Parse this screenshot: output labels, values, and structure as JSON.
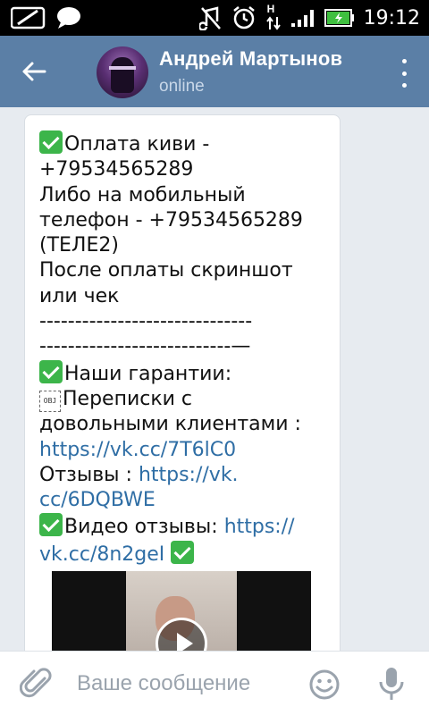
{
  "status_bar": {
    "time": "19:12",
    "icons": [
      "messenger-icon",
      "chat-bubble-icon",
      "mute-icon",
      "alarm-icon",
      "data-arrows-icon",
      "signal-icon",
      "battery-icon"
    ],
    "network_label": "H"
  },
  "header": {
    "contact_name": "Андрей Мартынов",
    "contact_status": "online",
    "back_icon": "back-arrow-icon",
    "menu_icon": "more-vert-icon"
  },
  "message": {
    "line1": "Оплата киви -",
    "line2": "+79534565289",
    "line3": "Либо на мобильный",
    "line4": "телефон - +79534565289",
    "line5": "(ТЕЛЕ2)",
    "line6": "После оплаты скриншот",
    "line7": "или чек",
    "line8": "------------------------------",
    "line9": "---------------------------—",
    "line10": "Наши гарантии:",
    "obj_glyph": "OBJ",
    "line11": "Переписки с",
    "line12": "довольными клиентами :",
    "link1": "https://vk.cc/7T6lC0",
    "reviews_label": "Отзывы : ",
    "link2a": "https://vk.",
    "link2b": "cc/6DQBWE",
    "video_reviews_label": "Видео отзывы: ",
    "link3a": "https://",
    "link3b": "vk.cc/8n2geI"
  },
  "input_bar": {
    "placeholder": "Ваше сообщение",
    "attach_icon": "paperclip-icon",
    "emoji_icon": "smiley-icon",
    "mic_icon": "microphone-icon"
  },
  "colors": {
    "header": "#5b7fa6",
    "link": "#2f6ea5",
    "check": "#3cb54a",
    "chat_bg": "#e7ebf0"
  }
}
